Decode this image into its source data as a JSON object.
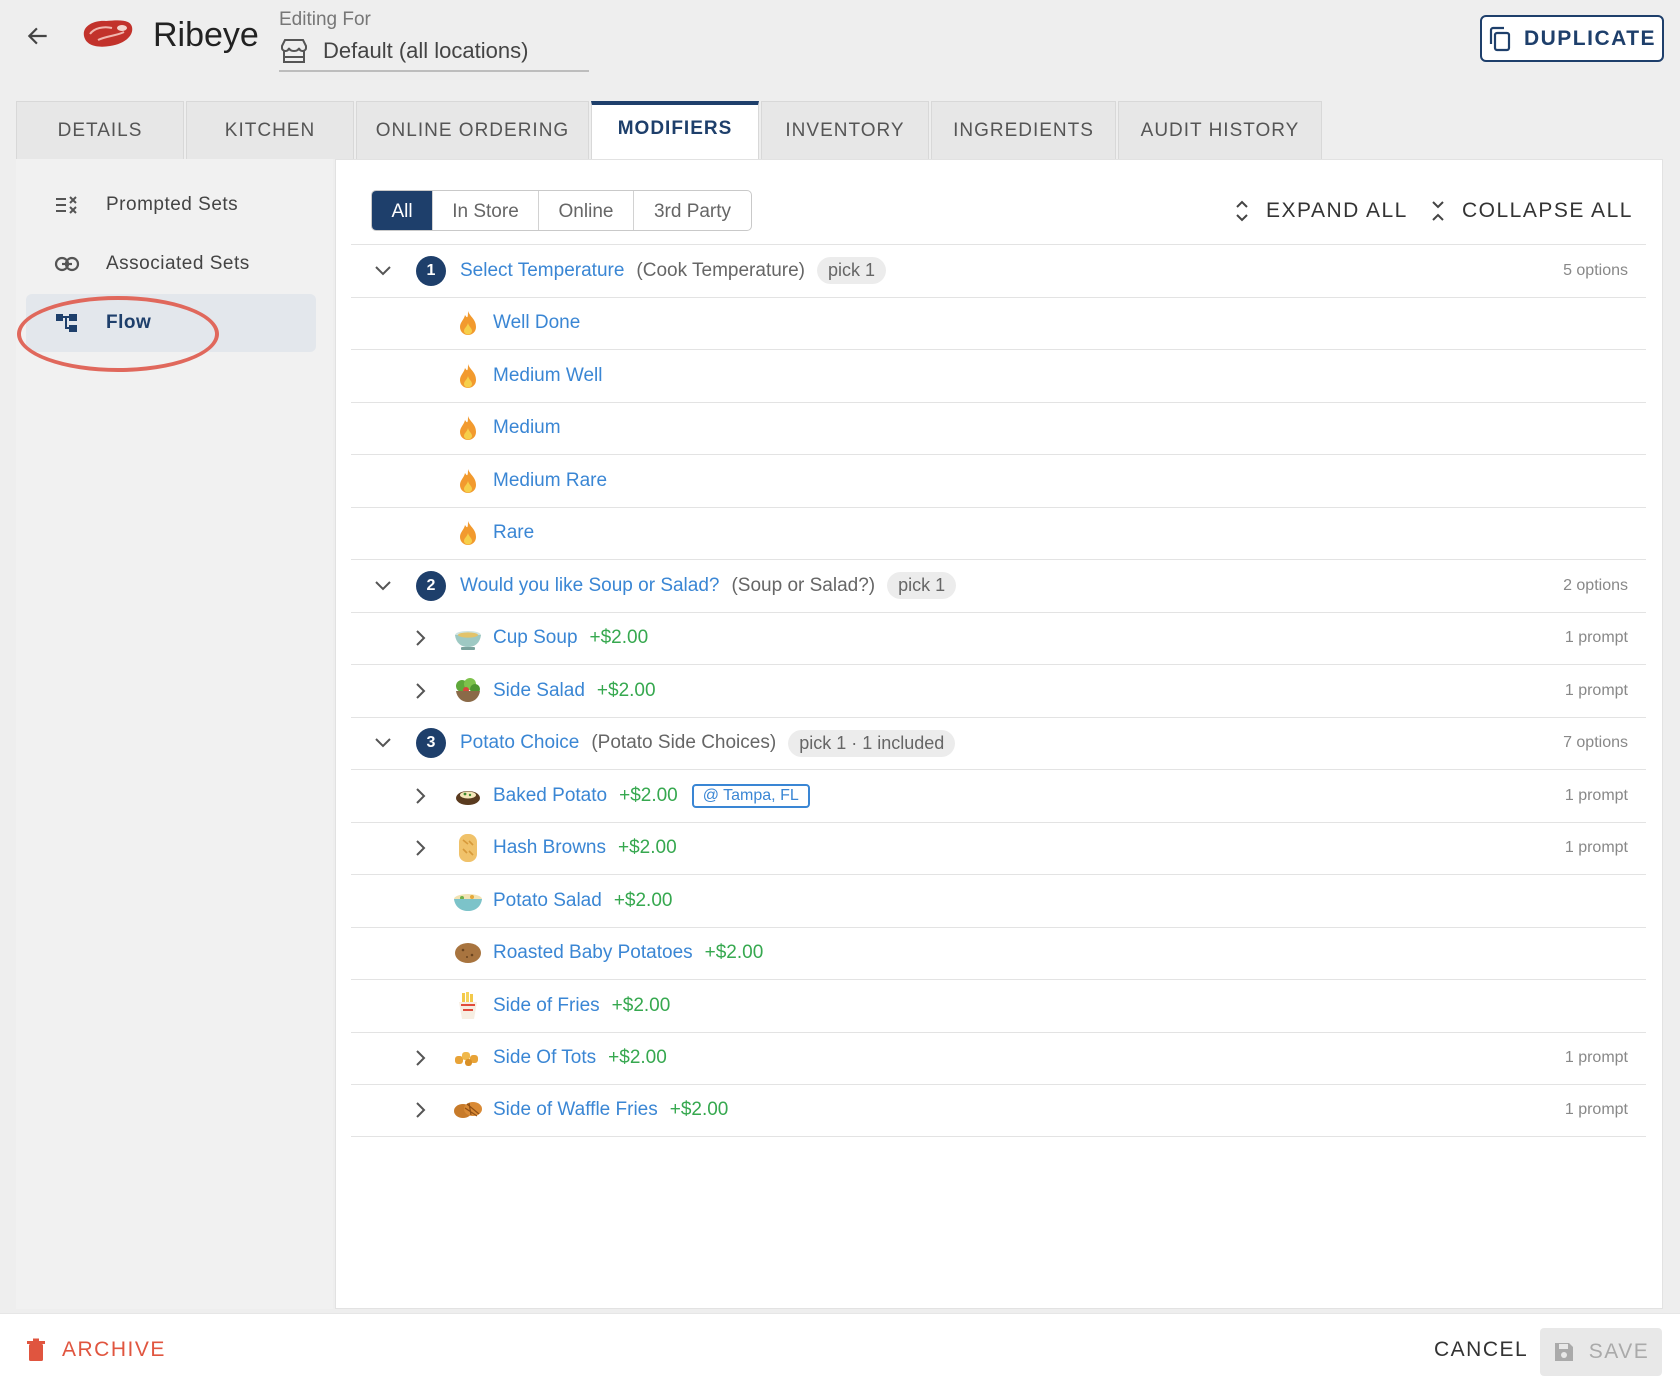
{
  "header": {
    "item_name": "Ribeye",
    "editing_for_label": "Editing For",
    "location": "Default (all locations)",
    "duplicate_label": "DUPLICATE"
  },
  "tabs": [
    {
      "label": "DETAILS",
      "active": false
    },
    {
      "label": "KITCHEN",
      "active": false
    },
    {
      "label": "ONLINE ORDERING",
      "active": false
    },
    {
      "label": "MODIFIERS",
      "active": true
    },
    {
      "label": "INVENTORY",
      "active": false
    },
    {
      "label": "INGREDIENTS",
      "active": false
    },
    {
      "label": "AUDIT HISTORY",
      "active": false
    }
  ],
  "sidebar": {
    "items": [
      {
        "label": "Prompted Sets",
        "icon": "checklist-icon",
        "active": false
      },
      {
        "label": "Associated Sets",
        "icon": "link-icon",
        "active": false
      },
      {
        "label": "Flow",
        "icon": "flow-tree-icon",
        "active": true
      }
    ]
  },
  "filters": {
    "options": [
      "All",
      "In Store",
      "Online",
      "3rd Party"
    ],
    "selected": "All"
  },
  "controls": {
    "expand_all": "EXPAND ALL",
    "collapse_all": "COLLAPSE ALL"
  },
  "groups": [
    {
      "number": "1",
      "name": "Select Temperature",
      "alias": "(Cook Temperature)",
      "pick": "pick 1",
      "count": "5 options",
      "options": [
        {
          "name": "Well Done",
          "icon": "flame-icon"
        },
        {
          "name": "Medium Well",
          "icon": "flame-icon"
        },
        {
          "name": "Medium",
          "icon": "flame-icon"
        },
        {
          "name": "Medium Rare",
          "icon": "flame-icon"
        },
        {
          "name": "Rare",
          "icon": "flame-icon"
        }
      ]
    },
    {
      "number": "2",
      "name": "Would you like Soup or Salad?",
      "alias": "(Soup or Salad?)",
      "pick": "pick 1",
      "count": "2 options",
      "options": [
        {
          "name": "Cup Soup",
          "price": "+$2.00",
          "icon": "soup-icon",
          "prompt": "1 prompt"
        },
        {
          "name": "Side Salad",
          "price": "+$2.00",
          "icon": "salad-icon",
          "prompt": "1 prompt"
        }
      ]
    },
    {
      "number": "3",
      "name": "Potato Choice",
      "alias": "(Potato Side Choices)",
      "pick": "pick 1 · 1 included",
      "count": "7 options",
      "options": [
        {
          "name": "Baked Potato",
          "price": "+$2.00",
          "icon": "baked-potato-icon",
          "prompt": "1 prompt",
          "tag": "@ Tampa, FL"
        },
        {
          "name": "Hash Browns",
          "price": "+$2.00",
          "icon": "hash-browns-icon",
          "prompt": "1 prompt"
        },
        {
          "name": "Potato Salad",
          "price": "+$2.00",
          "icon": "potato-salad-icon"
        },
        {
          "name": "Roasted Baby Potatoes",
          "price": "+$2.00",
          "icon": "potato-icon"
        },
        {
          "name": "Side of Fries",
          "price": "+$2.00",
          "icon": "fries-icon"
        },
        {
          "name": "Side Of Tots",
          "price": "+$2.00",
          "icon": "tots-icon",
          "prompt": "1 prompt"
        },
        {
          "name": "Side of Waffle Fries",
          "price": "+$2.00",
          "icon": "waffle-fries-icon",
          "prompt": "1 prompt"
        }
      ]
    }
  ],
  "footer": {
    "archive_label": "ARCHIVE",
    "cancel_label": "CANCEL",
    "save_label": "SAVE"
  },
  "colors": {
    "primary": "#1e3f6b",
    "link": "#3a86d4",
    "price": "#36a84f",
    "danger": "#e0553f",
    "highlight": "#e0685c"
  }
}
